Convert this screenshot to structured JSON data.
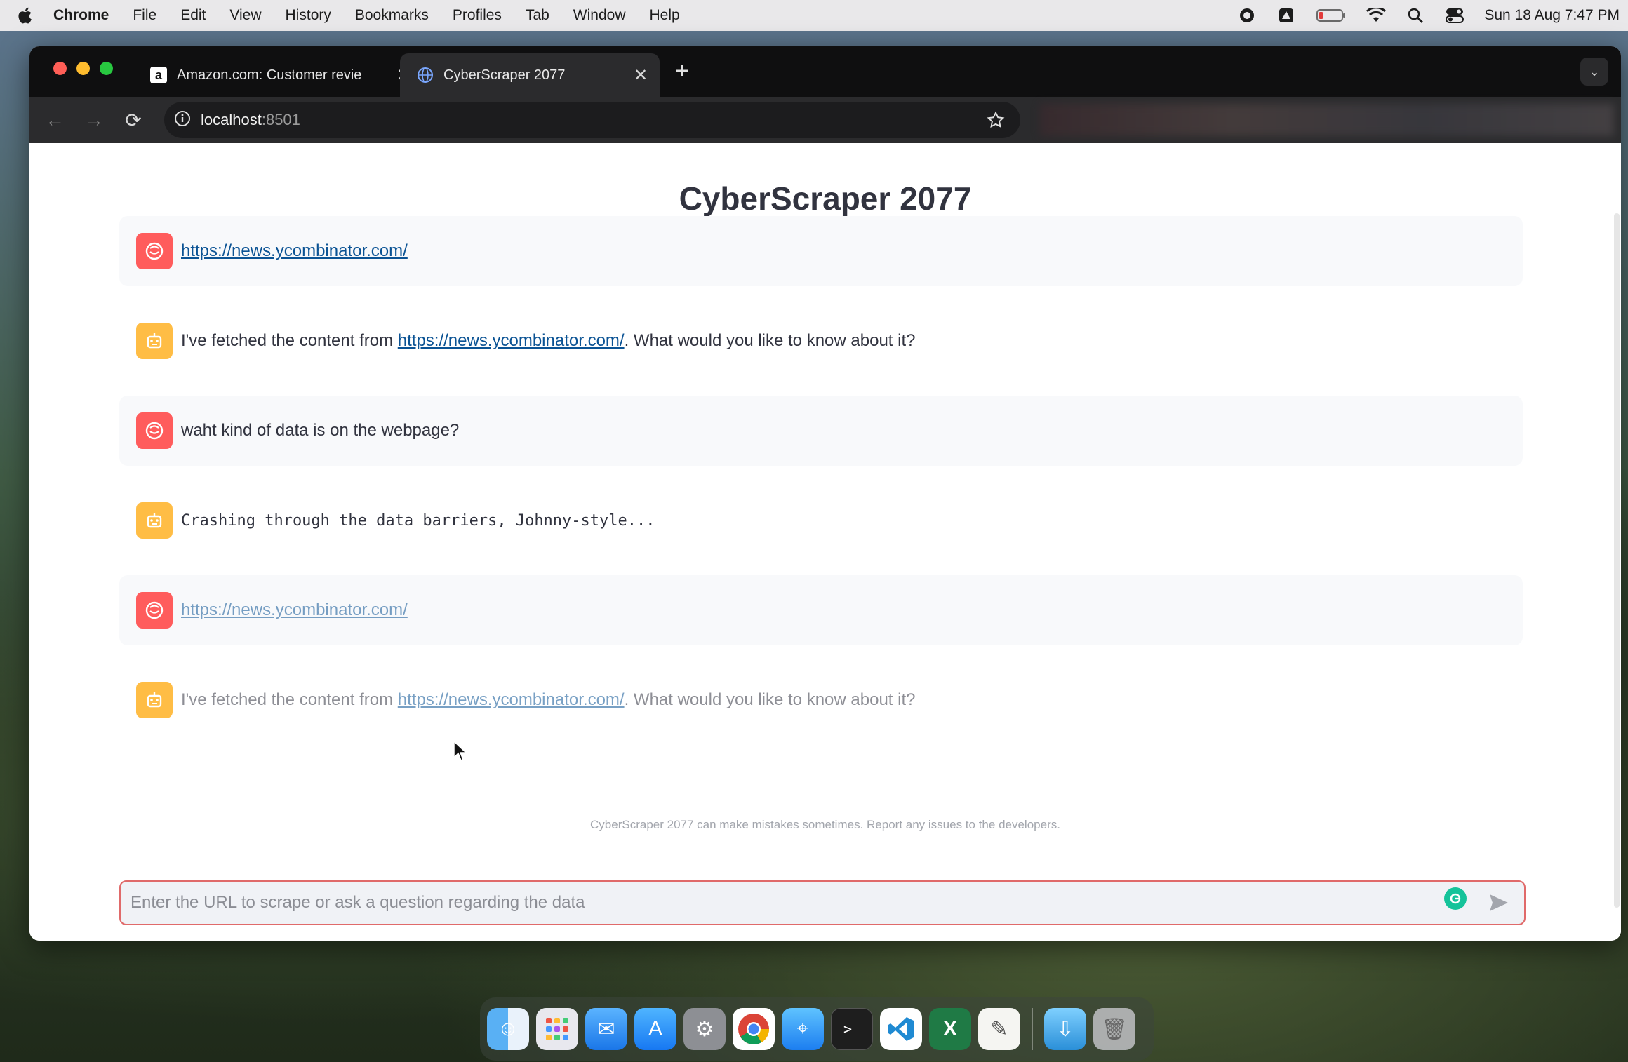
{
  "menubar": {
    "app_name": "Chrome",
    "items": [
      "File",
      "Edit",
      "View",
      "History",
      "Bookmarks",
      "Profiles",
      "Tab",
      "Window",
      "Help"
    ],
    "datetime": "Sun 18 Aug  7:47 PM"
  },
  "browser": {
    "tabs": [
      {
        "title": "Amazon.com: Customer revie",
        "favicon": "amazon-icon"
      },
      {
        "title": "CyberScraper 2077",
        "favicon": "globe-icon",
        "active": true
      }
    ],
    "url_host": "localhost",
    "url_port": ":8501"
  },
  "page": {
    "title": "CyberScraper 2077",
    "messages": [
      {
        "role": "user",
        "link": "https://news.ycombinator.com/"
      },
      {
        "role": "assistant",
        "before": "I've fetched the content from ",
        "link": "https://news.ycombinator.com/",
        "after": ". What would you like to know about it?"
      },
      {
        "role": "user",
        "text": "waht kind of data is on the webpage?"
      },
      {
        "role": "assistant",
        "mono": "Crashing through the data barriers, Johnny-style..."
      },
      {
        "role": "user",
        "link": "https://news.ycombinator.com/"
      },
      {
        "role": "assistant",
        "before": "I've fetched the content from ",
        "link": "https://news.ycombinator.com/",
        "after": ". What would you like to know about it?"
      }
    ],
    "disclaimer": "CyberScraper 2077 can make mistakes sometimes. Report any issues to the developers.",
    "input_placeholder": "Enter the URL to scrape or ask a question regarding the data"
  },
  "colors": {
    "user_avatar": "#ff5c5c",
    "bot_avatar": "#ffbd45",
    "link": "#0b5394",
    "input_border": "#e06a6a"
  },
  "dock": [
    "finder-icon",
    "launchpad-icon",
    "mail-icon",
    "app-store-icon",
    "system-settings-icon",
    "chrome-icon",
    "safari-icon",
    "terminal-icon",
    "vscode-icon",
    "excel-icon",
    "textedit-icon",
    "downloads-icon",
    "trash-icon"
  ]
}
